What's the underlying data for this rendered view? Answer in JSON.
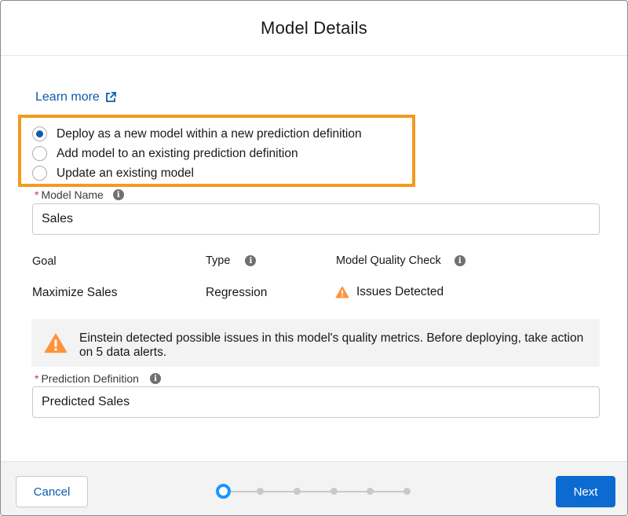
{
  "modal": {
    "title": "Model Details"
  },
  "learn_more": {
    "label": "Learn more",
    "icon": "external-link-icon"
  },
  "deploy_options": [
    {
      "label": "Deploy as a new model within a new prediction definition",
      "selected": true
    },
    {
      "label": "Add model to an existing prediction definition",
      "selected": false
    },
    {
      "label": "Update an existing model",
      "selected": false
    }
  ],
  "model_name": {
    "label": "Model Name",
    "required_marker": "*",
    "value": "Sales"
  },
  "details": {
    "goal": {
      "label": "Goal",
      "value": "Maximize Sales"
    },
    "type": {
      "label": "Type",
      "value": "Regression"
    },
    "quality_check": {
      "label": "Model Quality Check",
      "value": "Issues Detected",
      "status_icon": "warning-icon"
    }
  },
  "warning_banner": {
    "message": "Einstein detected possible issues in this model's quality metrics. Before deploying, take action on 5 data alerts.",
    "icon": "warning-icon"
  },
  "prediction_definition": {
    "label": "Prediction Definition",
    "required_marker": "*",
    "value": "Predicted Sales"
  },
  "footer": {
    "cancel_label": "Cancel",
    "next_label": "Next",
    "progress": {
      "total_steps": 6,
      "current_step": 1
    }
  },
  "colors": {
    "accent": "#0b5cab",
    "primary_button": "#0b6bd0",
    "highlight_border": "#f39a1e",
    "warning": "#fe9339",
    "progress_active": "#1b96ff",
    "required": "#c23934"
  }
}
